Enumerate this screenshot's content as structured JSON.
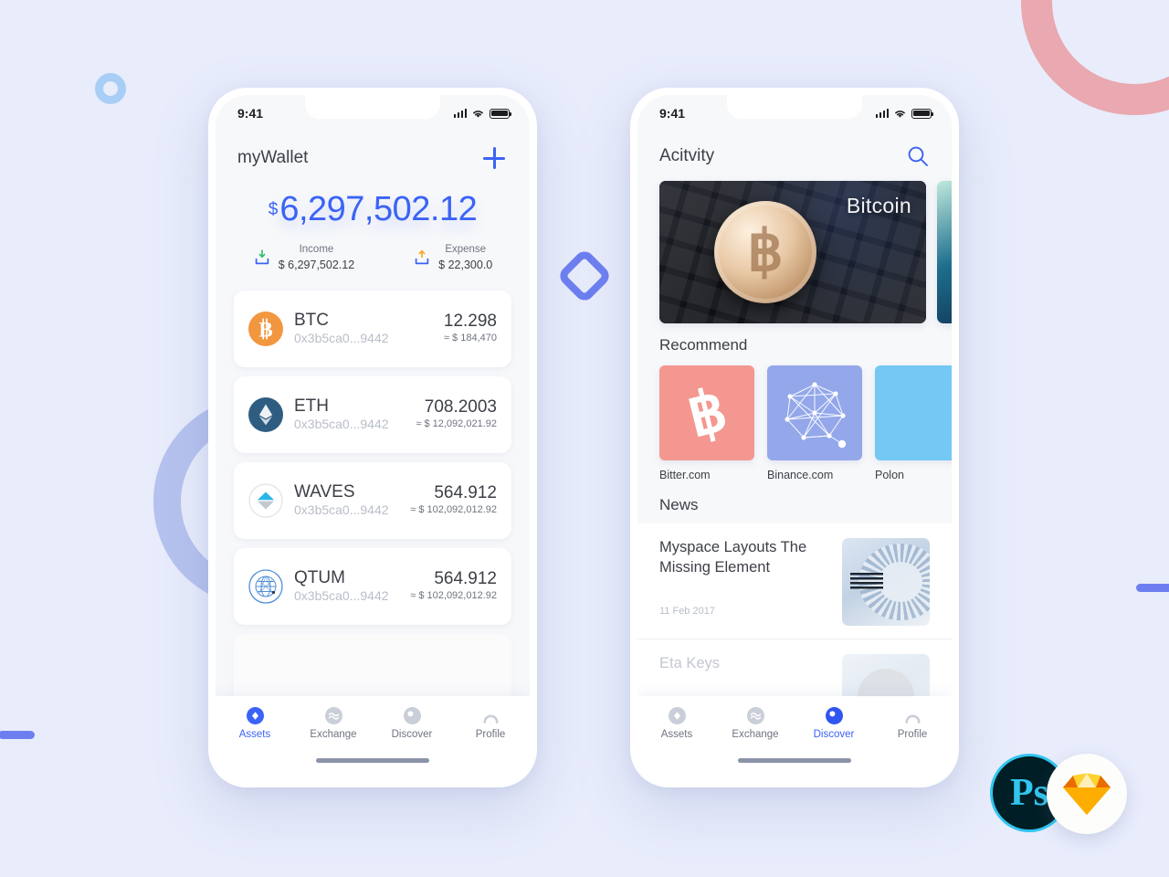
{
  "background": {
    "page_color": "#e8ecfb",
    "accent_blue": "#3b63f5",
    "deco_pink": "#eaa8b0",
    "deco_periwinkle": "#b6c2ee",
    "deco_light_blue": "#a9cef5"
  },
  "phone1": {
    "status": {
      "time": "9:41"
    },
    "header": {
      "title": "myWallet",
      "add_label": "+"
    },
    "balance": {
      "currency_symbol": "$",
      "amount": "6,297,502.12"
    },
    "summary": [
      {
        "label": "Income",
        "value": "$ 6,297,502.12",
        "icon": "download-tray-icon"
      },
      {
        "label": "Expense",
        "value": "$ 22,300.0",
        "icon": "upload-tray-icon"
      }
    ],
    "assets": [
      {
        "symbol": "BTC",
        "address": "0x3b5ca0...9442",
        "amount": "12.298",
        "fiat": "≈ $ 184,470",
        "icon": "bitcoin-coin-icon"
      },
      {
        "symbol": "ETH",
        "address": "0x3b5ca0...9442",
        "amount": "708.2003",
        "fiat": "≈ $ 12,092,021.92",
        "icon": "ethereum-coin-icon"
      },
      {
        "symbol": "WAVES",
        "address": "0x3b5ca0...9442",
        "amount": "564.912",
        "fiat": "≈ $ 102,092,012.92",
        "icon": "waves-coin-icon"
      },
      {
        "symbol": "QTUM",
        "address": "0x3b5ca0...9442",
        "amount": "564.912",
        "fiat": "≈ $ 102,092,012.92",
        "icon": "qtum-coin-icon"
      }
    ],
    "tabs": [
      {
        "label": "Assets",
        "icon": "diamond-icon",
        "active": true
      },
      {
        "label": "Exchange",
        "icon": "waves-icon",
        "active": false
      },
      {
        "label": "Discover",
        "icon": "compass-icon",
        "active": false
      },
      {
        "label": "Profile",
        "icon": "person-icon",
        "active": false
      }
    ]
  },
  "phone2": {
    "status": {
      "time": "9:41"
    },
    "header": {
      "title": "Acitvity",
      "search_icon": "search-icon"
    },
    "banner": {
      "caption": "Bitcoin"
    },
    "recommend": {
      "title": "Recommend",
      "items": [
        {
          "label": "Bitter.com",
          "color": "#f39790",
          "icon": "bitcoin-glyph-icon"
        },
        {
          "label": "Binance.com",
          "color": "#93a7ea",
          "icon": "network-graph-icon"
        },
        {
          "label": "Polon",
          "color": "#74c8f3",
          "icon": "sparkle-icon"
        }
      ]
    },
    "news": {
      "title": "News",
      "items": [
        {
          "headline": "Myspace Layouts The Missing Element",
          "date": "11 Feb 2017",
          "thumb": "ibm-server-thumb"
        },
        {
          "headline": "Eta Keys",
          "date": "",
          "thumb": "portrait-thumb"
        }
      ]
    },
    "tabs": [
      {
        "label": "Assets",
        "icon": "diamond-icon",
        "active": false
      },
      {
        "label": "Exchange",
        "icon": "waves-icon",
        "active": false
      },
      {
        "label": "Discover",
        "icon": "compass-icon",
        "active": true
      },
      {
        "label": "Profile",
        "icon": "person-icon",
        "active": false
      }
    ]
  },
  "logos": [
    {
      "name": "photoshop-logo",
      "text": "Ps"
    },
    {
      "name": "sketch-logo",
      "text": ""
    }
  ]
}
